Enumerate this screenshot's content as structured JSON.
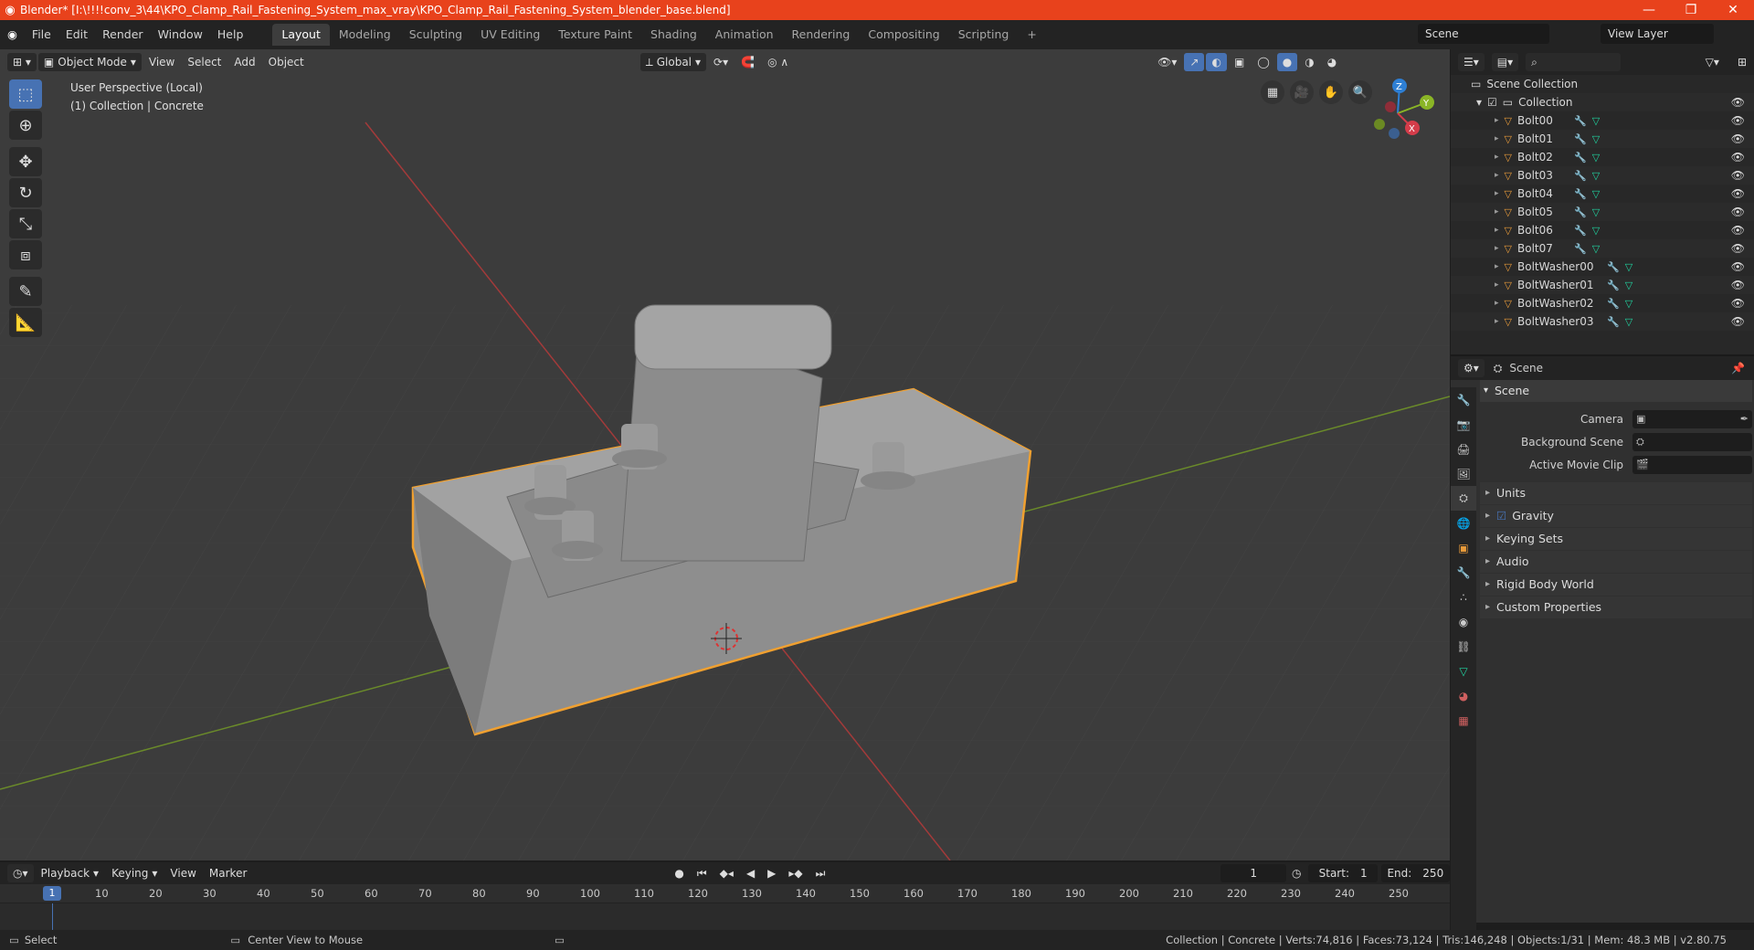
{
  "window": {
    "title": "Blender* [I:\\!!!!conv_3\\44\\KPO_Clamp_Rail_Fastening_System_max_vray\\KPO_Clamp_Rail_Fastening_System_blender_base.blend]",
    "minimize": "—",
    "restore": "❐",
    "close": "✕"
  },
  "menu": [
    "File",
    "Edit",
    "Render",
    "Window",
    "Help"
  ],
  "workspaces": [
    "Layout",
    "Modeling",
    "Sculpting",
    "UV Editing",
    "Texture Paint",
    "Shading",
    "Animation",
    "Rendering",
    "Compositing",
    "Scripting"
  ],
  "workspace_add": "+",
  "scene_name": "Scene",
  "view_layer": "View Layer",
  "viewport": {
    "mode": "Object Mode",
    "menus": [
      "View",
      "Select",
      "Add",
      "Object"
    ],
    "transform_orientation": "Global",
    "info_line1": "User Perspective (Local)",
    "info_line2": "(1) Collection | Concrete",
    "gizmo_labels": {
      "z": "Z",
      "y": "Y",
      "x": "X"
    }
  },
  "outliner": {
    "root": "Scene Collection",
    "collection": "Collection",
    "objects": [
      "Bolt00",
      "Bolt01",
      "Bolt02",
      "Bolt03",
      "Bolt04",
      "Bolt05",
      "Bolt06",
      "Bolt07",
      "BoltWasher00",
      "BoltWasher01",
      "BoltWasher02",
      "BoltWasher03"
    ]
  },
  "properties": {
    "header": "Scene",
    "panel": "Scene",
    "camera_label": "Camera",
    "background_scene_label": "Background Scene",
    "active_clip_label": "Active Movie Clip",
    "subpanels": [
      "Units",
      "Gravity",
      "Keying Sets",
      "Audio",
      "Rigid Body World",
      "Custom Properties"
    ]
  },
  "timeline": {
    "menus": [
      "Playback",
      "Keying",
      "View",
      "Marker"
    ],
    "current_frame": "1",
    "start_label": "Start:",
    "start": "1",
    "end_label": "End:",
    "end": "250",
    "ticks": [
      "10",
      "20",
      "30",
      "40",
      "50",
      "60",
      "70",
      "80",
      "90",
      "100",
      "110",
      "120",
      "130",
      "140",
      "150",
      "160",
      "170",
      "180",
      "190",
      "200",
      "210",
      "220",
      "230",
      "240",
      "250"
    ]
  },
  "status": {
    "left": "Select",
    "middle": "Center View to Mouse",
    "right": "Collection | Concrete | Verts:74,816 | Faces:73,124 | Tris:146,248 | Objects:1/31 | Mem: 48.3 MB | v2.80.75"
  }
}
